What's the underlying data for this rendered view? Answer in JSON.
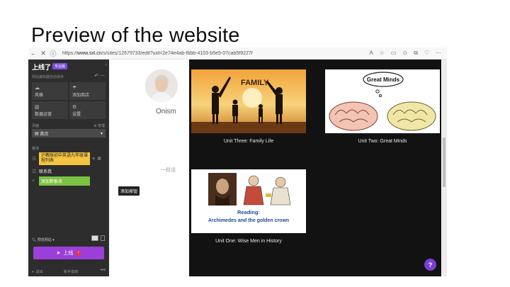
{
  "slide": {
    "title": "Preview of the website"
  },
  "browser": {
    "url_prefix": "https://",
    "url_host": "www.sxl.cn",
    "url_path": "/s/sites/12679733/edit?uid=2e74e4ab-fbbb-4103-b5e5-07cab5f9227f",
    "back_icon": "←",
    "close_icon": "✕",
    "toolbar_icons": [
      "A",
      "☆",
      "▭",
      "✩",
      "⧉",
      "♡",
      "⋯"
    ]
  },
  "sidebar": {
    "brand": "上线了",
    "badge": "专业版",
    "subtitle": "网站编辑器自动保存",
    "tiles": [
      {
        "icon": "☁",
        "label": "风格"
      },
      {
        "icon": "☂",
        "label": "添加商店"
      },
      {
        "icon": "▥",
        "label": "数据运营"
      },
      {
        "icon": "⚙",
        "label": "设置"
      }
    ],
    "pages_label": "页面",
    "manage_label": "管理",
    "current_page": "首页",
    "blocks_label": "板块",
    "blocks": [
      {
        "label": "沪教版初中英语九年级课程列表"
      },
      {
        "label": "联系我"
      }
    ],
    "add_block": "添加新板块",
    "preview_label": "预览网站 ▾",
    "publish_label": "上线",
    "publish_badge": "!",
    "bottom_left": "退出",
    "bottom_mid": "新手指南",
    "bottom_right": "•••"
  },
  "profile": {
    "name": "Onism",
    "para_hint": "一段话",
    "tooltip": "添加按钮"
  },
  "cards": [
    {
      "caption": "Unit Three: Family Life",
      "image_text": "FAMILY"
    },
    {
      "caption": "Unit Two: Great Minds",
      "image_text": "Great Minds"
    },
    {
      "caption": "Unit One: Wise Men in History",
      "image_text_1": "Reading:",
      "image_text_2": "Archimedes and the golden crown"
    }
  ],
  "help": "?",
  "colors": {
    "sidebar_bg": "#2d2d2d",
    "publish": "#9b3fd8",
    "block_yellow": "#f5c542",
    "block_green": "#7cc242",
    "canvas_bg": "#121212"
  }
}
